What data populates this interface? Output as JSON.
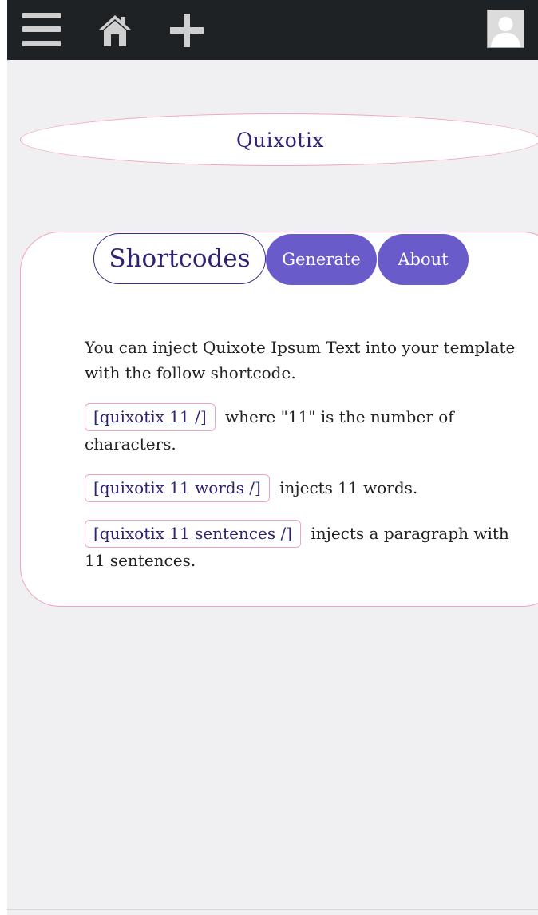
{
  "header": {
    "icons": [
      "menu-icon",
      "home-icon",
      "add-icon",
      "avatar"
    ]
  },
  "brand": {
    "title": "Quixotix"
  },
  "tabs": [
    {
      "label": "Shortcodes",
      "active": true
    },
    {
      "label": "Generate",
      "active": false
    },
    {
      "label": "About",
      "active": false
    }
  ],
  "content": {
    "intro": "You can inject Quixote Ipsum Text into your template with the follow shortcode.",
    "items": [
      {
        "code": "[quixotix 11 /]",
        "text": "where \"11\" is the number of characters."
      },
      {
        "code": "[quixotix 11 words /]",
        "text": "injects 11 words."
      },
      {
        "code": "[quixotix 11 sentences /]",
        "text": "injects a paragraph with 11 sentences."
      }
    ]
  },
  "colors": {
    "topbar": "#1f2225",
    "accent": "#6a5bcb",
    "title_text": "#2f2275",
    "border_pink": "#f2a4bf",
    "page_bg": "#f0eff1"
  }
}
